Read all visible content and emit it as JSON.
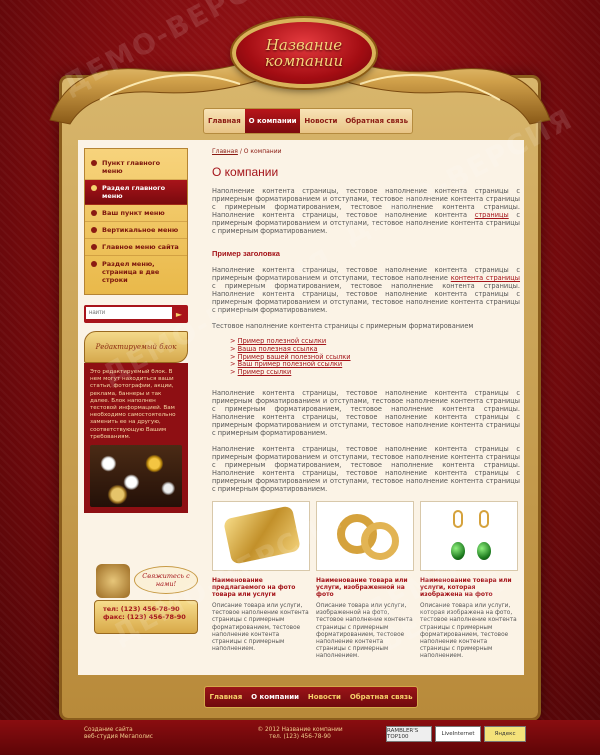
{
  "brand": {
    "line1": "Название",
    "line2": "компании"
  },
  "top_nav": [
    {
      "label": "Главная",
      "active": false
    },
    {
      "label": "О компании",
      "active": true
    },
    {
      "label": "Новости",
      "active": false
    },
    {
      "label": "Обратная связь",
      "active": false
    }
  ],
  "sidebar": {
    "items": [
      {
        "label": "Пункт главного меню",
        "active": false
      },
      {
        "label": "Раздел главного меню",
        "active": true
      },
      {
        "label": "Ваш пункт меню",
        "active": false
      },
      {
        "label": "Вертикальное меню",
        "active": false
      },
      {
        "label": "Главное меню сайта",
        "active": false
      },
      {
        "label": "Раздел меню, страница в две строки",
        "active": false
      }
    ],
    "search_placeholder": "найти",
    "blog_title": "Редактируемый блок",
    "blog_text": "Это редактируемый блок. В нем могут находиться ваши статьи, фотографии, акции, реклама, баннеры и так далее. Блок наполнен тестовой информацией. Вам необходимо самостоятельно заменить ее на другую, соответствующую Вашим требованиям."
  },
  "contact": {
    "call_label": "Свяжитесь с нами!",
    "tel": "тел: (123) 456-78-90",
    "fax": "факс: (123) 456-78-90"
  },
  "main": {
    "breadcrumb_home": "Главная",
    "breadcrumb_current": " / О компании",
    "title": "О компании",
    "p1a": "Наполнение контента страницы, тестовое наполнение контента страницы с примерным форматированием и отступами, тестовое наполнение контента страницы с примерным форматированием, тестовое наполнение контента страницы. Наполнение контента страницы, тестовое наполнение контента ",
    "p1_link": "страницы",
    "p1b": " с примерным форматированием и отступами, тестовое наполнение контента страницы с примерным форматированием.",
    "subtitle": "Пример заголовка",
    "p2a": "Наполнение контента страницы, тестовое наполнение контента страницы с примерным форматированием и отступами, тестовое наполнение ",
    "p2_link": "контента страницы",
    "p2b": " с примерным форматированием, тестовое наполнение контента страницы. Наполнение контента страницы, тестовое наполнение контента страницы с примерным форматированием и отступами, тестовое наполнение контента страницы с примерным форматированием.",
    "p3": "Тестовое наполнение контента страницы с примерным форматированием",
    "links": [
      "Пример полезной ссылки",
      "Ваша полезная ссылка",
      "Пример вашей полезной ссылки",
      "Ваш пример полезной ссылки",
      "Пример ссылки"
    ],
    "p4": "Наполнение контента страницы, тестовое наполнение контента страницы с примерным форматированием и отступами, тестовое наполнение контента страницы с примерным форматированием, тестовое наполнение контента страницы. Наполнение контента страницы, тестовое наполнение контента страницы с примерным форматированием и отступами, тестовое наполнение контента страницы с примерным форматированием.",
    "p5": "Наполнение контента страницы, тестовое наполнение контента страницы с примерным форматированием и отступами, тестовое наполнение контента страницы с примерным форматированием, тестовое наполнение контента страницы. Наполнение контента страницы, тестовое наполнение контента страницы с примерным форматированием и отступами, тестовое наполнение контента страницы с примерным форматированием."
  },
  "products": [
    {
      "title": "Наименование предлагаемого на фото товара или услуги",
      "desc": "Описание товара или услуги, тестовое наполнение контента страницы с примерным форматированием, тестовое наполнение контента страницы с примерным наполнением."
    },
    {
      "title": "Наименование товара или услуги, изображенной на фото",
      "desc": "Описание товара или услуги, изображенной на фото, тестовое наполнение контента страницы с примерным форматированием, тестовое наполнение контента страницы с примерным наполнением."
    },
    {
      "title": "Наименование товара или услуги, которая изображена на фото",
      "desc": "Описание товара или услуги, которая изображена на фото, тестовое наполнение контента страницы с примерным форматированием, тестовое наполнение контента страницы с примерным наполнением."
    }
  ],
  "footer_nav": [
    {
      "label": "Главная",
      "active": false
    },
    {
      "label": "О компании",
      "active": true
    },
    {
      "label": "Новости",
      "active": false
    },
    {
      "label": "Обратная связь",
      "active": false
    }
  ],
  "footer": {
    "left1": "Создание сайта",
    "left2": "веб-студия Мегаполис",
    "center1": "© 2012  Название компании",
    "center2": "тел. (123) 456-78-90",
    "badges": [
      "RAMBLER'S TOP100",
      "LiveInternet",
      "Яндекс"
    ]
  },
  "colors": {
    "accent": "#a4141a",
    "gold": "#e9b94a",
    "background": "#7a0f12"
  }
}
